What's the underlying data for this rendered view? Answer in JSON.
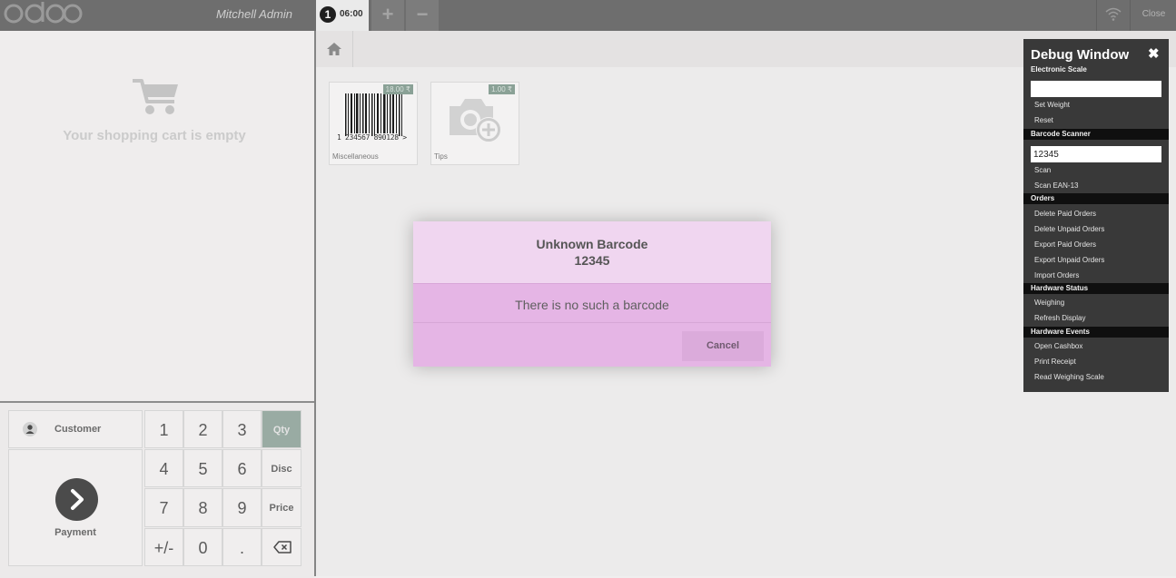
{
  "topbar": {
    "logo_text": "odoo",
    "user": "Mitchell Admin",
    "order": {
      "sequence": "1",
      "time": "06:00"
    },
    "add_label": "+",
    "remove_label": "−",
    "close_label": "Close"
  },
  "cart": {
    "empty_message": "Your shopping cart is empty"
  },
  "numpad": {
    "customer_label": "Customer",
    "payment_label": "Payment",
    "keys": [
      "1",
      "2",
      "3",
      "4",
      "5",
      "6",
      "7",
      "8",
      "9",
      "+/-",
      "0",
      "."
    ],
    "modes": [
      "Qty",
      "Disc",
      "Price"
    ],
    "active_mode": "Qty",
    "backspace_icon": "backspace-icon"
  },
  "products": [
    {
      "name": "Miscellaneous",
      "price": "18.00 ₹",
      "barcode_text": "1 234567 890128 >"
    },
    {
      "name": "Tips",
      "price": "1.00 ₹"
    }
  ],
  "dialog": {
    "title": "Unknown Barcode",
    "code": "12345",
    "body": "There is no such a barcode",
    "cancel_label": "Cancel"
  },
  "debug": {
    "title": "Debug Window",
    "close_icon": "close-icon",
    "scale_section": "Electronic Scale",
    "weight_value": "",
    "set_weight": "Set Weight",
    "reset": "Reset",
    "scanner_section": "Barcode Scanner",
    "barcode_value": "12345",
    "scan": "Scan",
    "scan_ean": "Scan EAN-13",
    "orders_section": "Orders",
    "delete_paid": "Delete Paid Orders",
    "delete_unpaid": "Delete Unpaid Orders",
    "export_paid": "Export Paid Orders",
    "export_unpaid": "Export Unpaid Orders",
    "import_orders": "Import Orders",
    "hw_status_section": "Hardware Status",
    "weighing": "Weighing",
    "refresh_display": "Refresh Display",
    "hw_events_section": "Hardware Events",
    "open_cashbox": "Open Cashbox",
    "print_receipt": "Print Receipt",
    "read_scale": "Read Weighing Scale"
  },
  "colors": {
    "topbar": "#6e6e6e",
    "accent_qty": "#99aba3",
    "dialog_header": "#f0d6f0",
    "dialog_body": "#e5b5e5",
    "debug_bg": "#393939"
  }
}
